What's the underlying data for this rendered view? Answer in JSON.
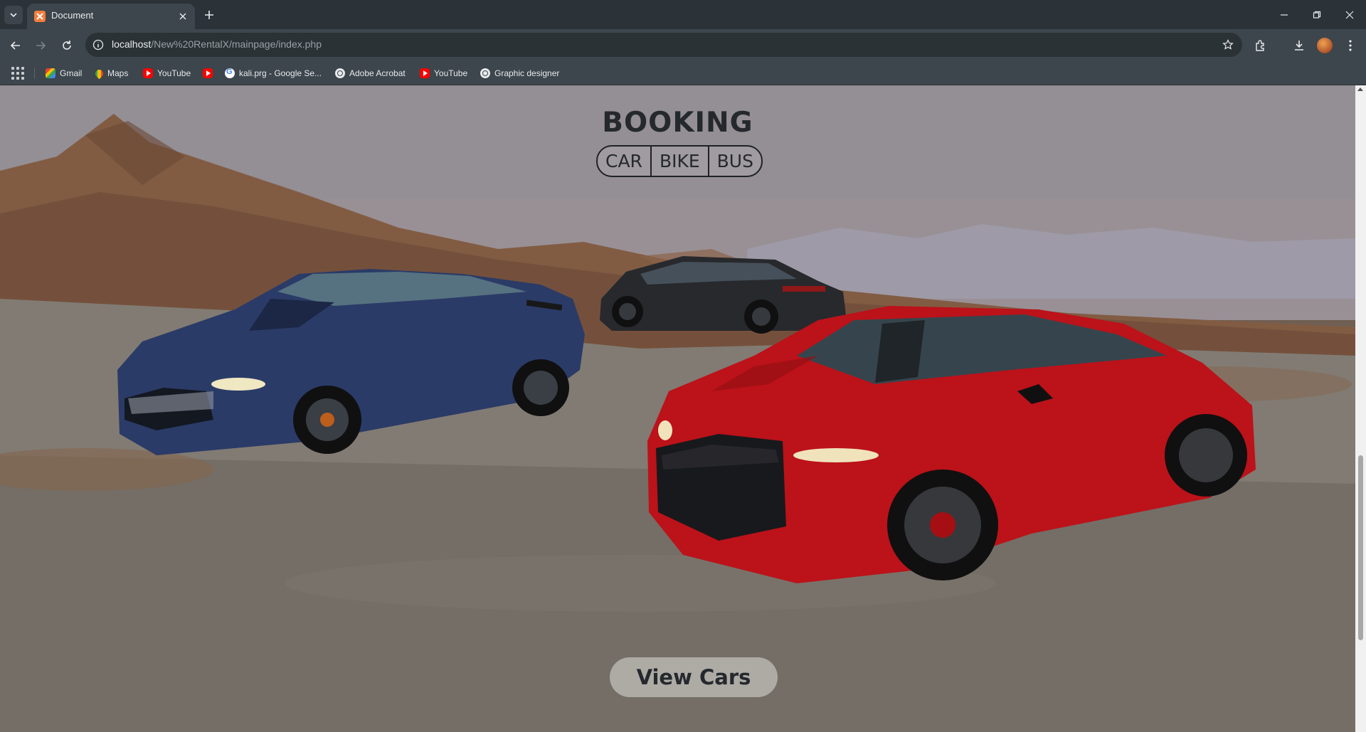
{
  "browser": {
    "tab_title": "Document",
    "url_host": "localhost",
    "url_path": "/New%20RentalX/mainpage/index.php"
  },
  "bookmarks": [
    {
      "label": "Gmail",
      "icon": "gmail-icon"
    },
    {
      "label": "Maps",
      "icon": "maps-icon"
    },
    {
      "label": "YouTube",
      "icon": "youtube-icon"
    },
    {
      "label": "",
      "icon": "youtube-icon"
    },
    {
      "label": "kali.prg - Google Se...",
      "icon": "google-icon"
    },
    {
      "label": "Adobe Acrobat",
      "icon": "globe-icon"
    },
    {
      "label": "YouTube",
      "icon": "youtube-icon"
    },
    {
      "label": "Graphic designer",
      "icon": "globe-icon"
    }
  ],
  "page": {
    "heading": "BOOKING",
    "vehicle_types": [
      "CAR",
      "BIKE",
      "BUS"
    ],
    "cta_label": "View Cars"
  },
  "colors": {
    "chrome_dark": "#2c3338",
    "chrome_toolbar": "#3c464c",
    "heading_text": "#25292e",
    "car_red": "#c8141c",
    "car_blue": "#2e3f6e",
    "car_black": "#2a2c30"
  }
}
